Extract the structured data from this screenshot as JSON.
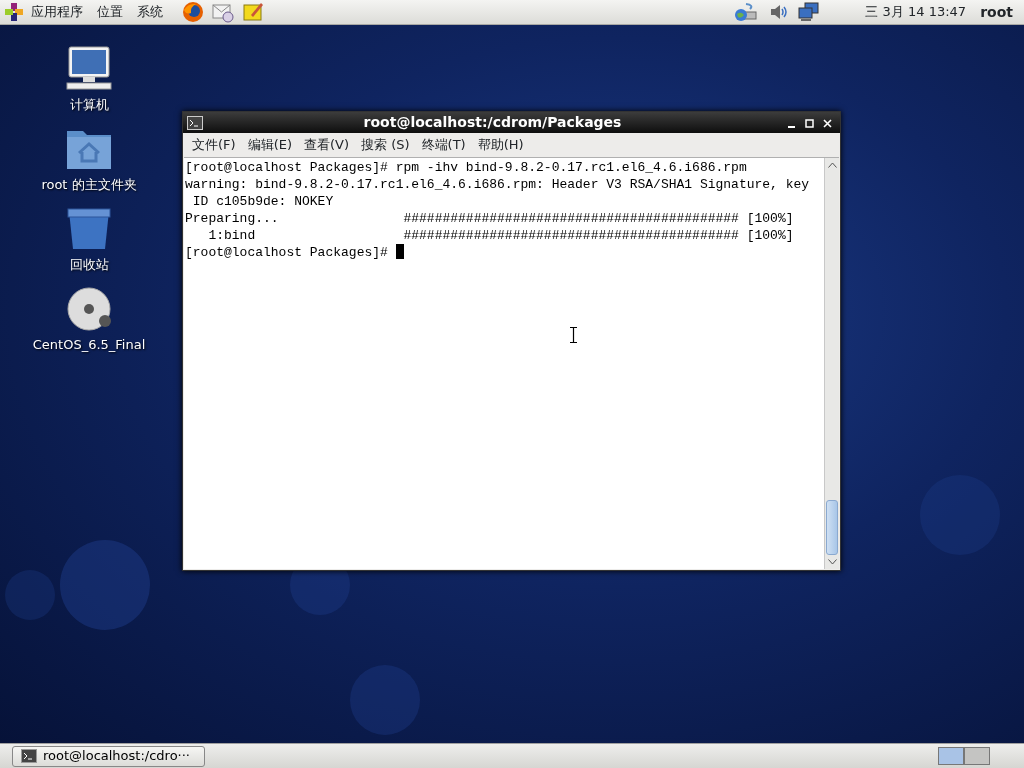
{
  "top_panel": {
    "menus": [
      "应用程序",
      "位置",
      "系统"
    ],
    "launchers": [
      {
        "kind": "browser"
      },
      {
        "kind": "mail"
      },
      {
        "kind": "notes"
      }
    ],
    "clock": "三 3月 14 13:47",
    "user": "root"
  },
  "desktop_icons": [
    {
      "kind": "computer",
      "label": "计算机"
    },
    {
      "kind": "home",
      "label": "root 的主文件夹"
    },
    {
      "kind": "trash",
      "label": "回收站"
    },
    {
      "kind": "disc",
      "label": "CentOS_6.5_Final"
    }
  ],
  "terminal": {
    "title": "root@localhost:/cdrom/Packages",
    "menu": [
      "文件(F)",
      "编辑(E)",
      "查看(V)",
      "搜索 (S)",
      "终端(T)",
      "帮助(H)"
    ],
    "lines": [
      "[root@localhost Packages]# rpm -ihv bind-9.8.2-0.17.rc1.el6_4.6.i686.rpm",
      "warning: bind-9.8.2-0.17.rc1.el6_4.6.i686.rpm: Header V3 RSA/SHA1 Signature, key",
      " ID c105b9de: NOKEY",
      "Preparing...                ########################################### [100%]",
      "   1:bind                   ########################################### [100%]",
      "[root@localhost Packages]# "
    ]
  },
  "taskbar": {
    "tasks": [
      {
        "label": "root@localhost:/cdro···",
        "selected": false
      }
    ],
    "workspaces": [
      {
        "selected": true
      },
      {
        "selected": false
      }
    ]
  }
}
